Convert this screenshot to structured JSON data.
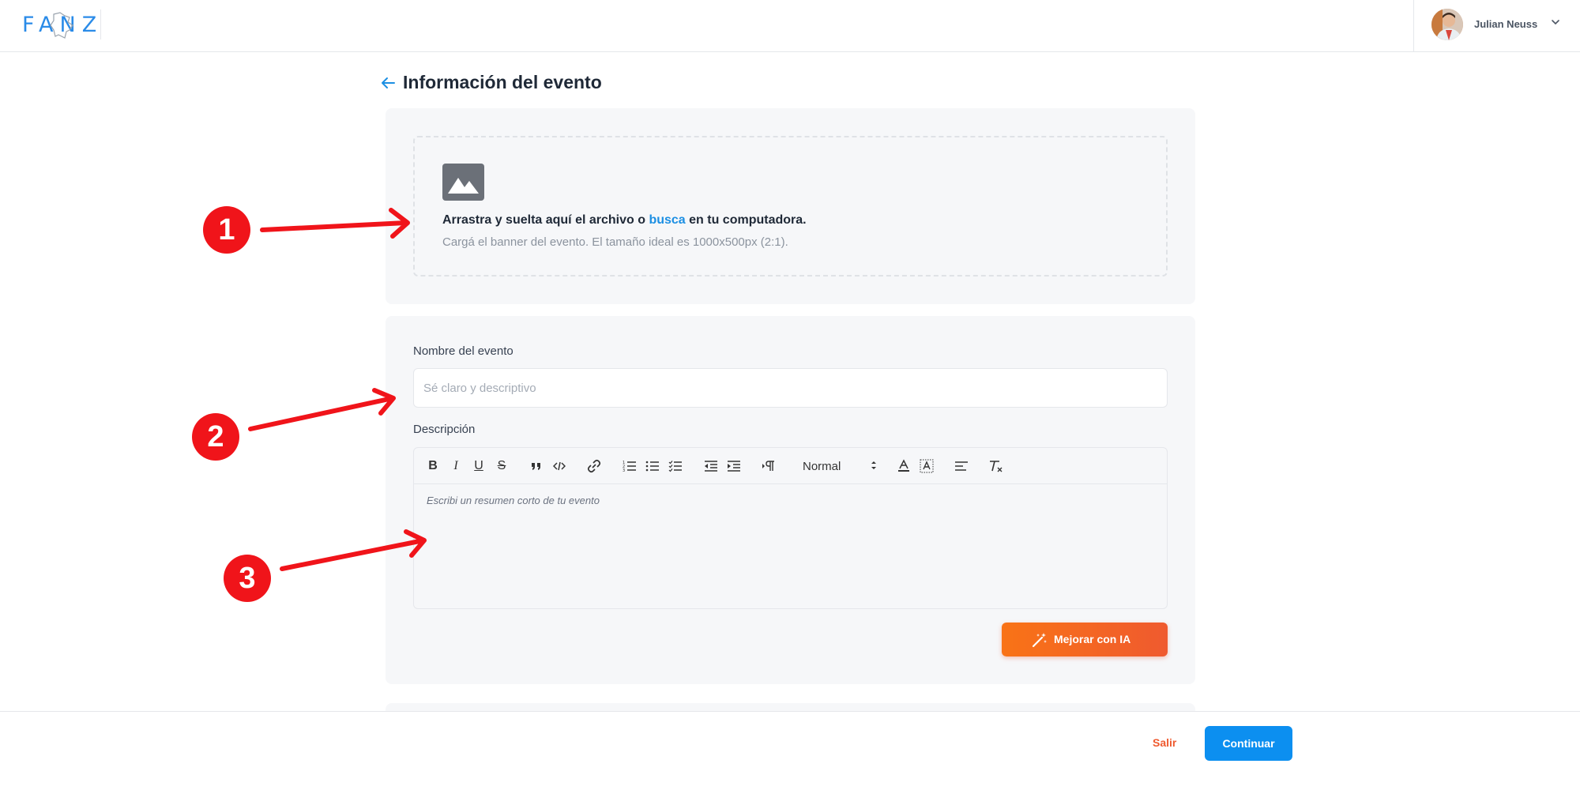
{
  "header": {
    "logo_text": "FANZ",
    "user_name": "Julian Neuss"
  },
  "page": {
    "title": "Información del evento"
  },
  "upload": {
    "text_before": "Arrastra y suelta aquí el archivo o ",
    "link": "busca",
    "text_after": " en tu computadora.",
    "hint": "Cargá el banner del evento. El tamaño ideal es 1000x500px (2:1)."
  },
  "form": {
    "name_label": "Nombre del evento",
    "name_placeholder": "Sé claro y descriptivo",
    "description_label": "Descripción",
    "description_placeholder": "Escribi un resumen corto de tu evento",
    "heading_select": "Normal",
    "ai_button": "Mejorar con IA"
  },
  "footer": {
    "exit": "Salir",
    "continue": "Continuar"
  },
  "annotations": {
    "badges": [
      "1",
      "2",
      "3"
    ],
    "color": "#f0141a"
  },
  "colors": {
    "accent": "#0c8ff0",
    "brand": "#2a8be8",
    "ai_gradient_start": "#f97316",
    "ai_gradient_end": "#ef5a2f"
  }
}
